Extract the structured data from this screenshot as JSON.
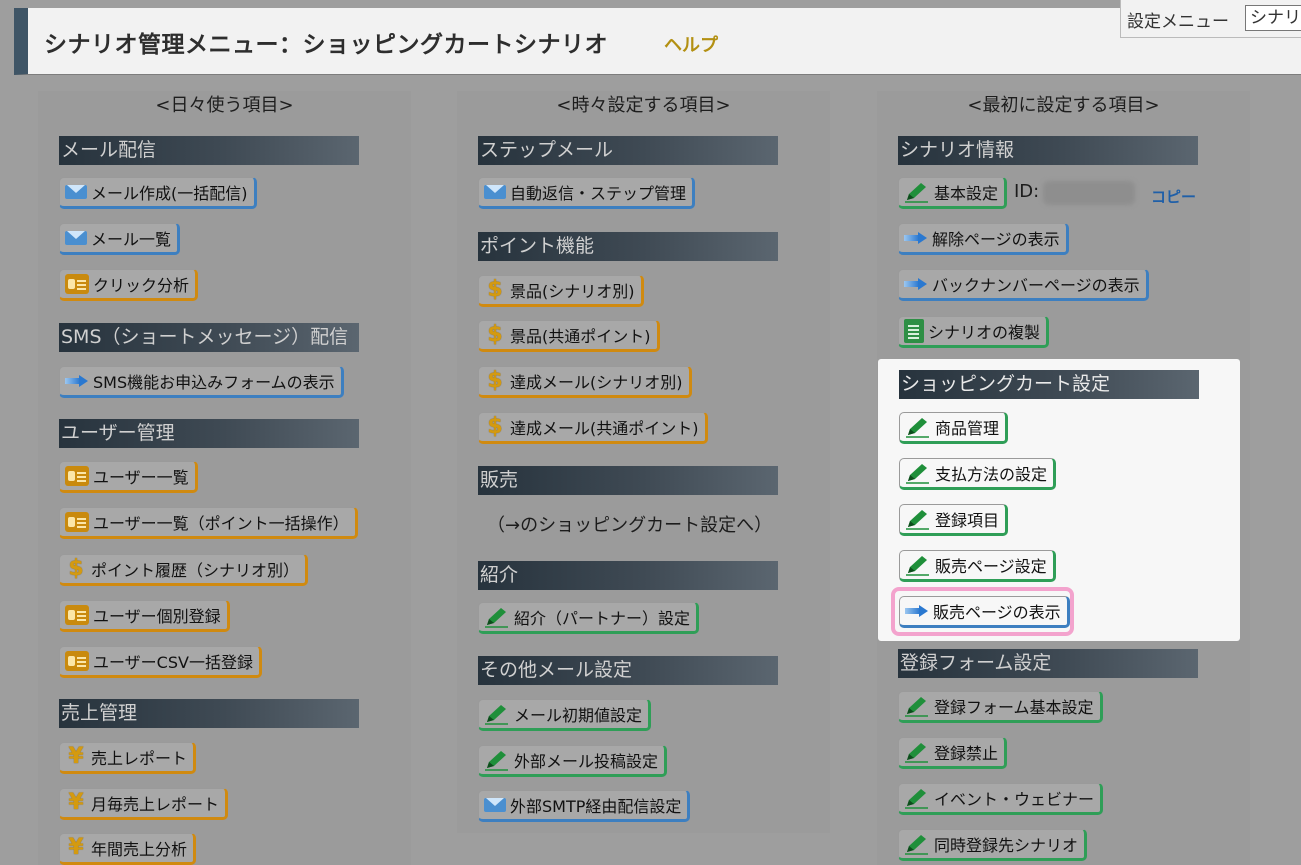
{
  "header": {
    "title": "シナリオ管理メニュー：ショッピングカートシナリオ",
    "help": "ヘルプ",
    "settings_menu_label": "設定メニュー",
    "settings_menu_value": "シナリ"
  },
  "columns": {
    "daily": {
      "title": "<日々使う項目>",
      "sections": {
        "mail": "メール配信",
        "sms": "SMS（ショートメッセージ）配信",
        "user": "ユーザー管理",
        "sales": "売上管理"
      },
      "buttons": {
        "mail_create": "メール作成(一括配信)",
        "mail_list": "メール一覧",
        "click_analysis": "クリック分析",
        "sms_form": "SMS機能お申込みフォームの表示",
        "user_list": "ユーザー一覧",
        "user_list_points": "ユーザー一覧（ポイント一括操作）",
        "point_history": "ポイント履歴（シナリオ別）",
        "user_register": "ユーザー個別登録",
        "user_csv": "ユーザーCSV一括登録",
        "sales_report": "売上レポート",
        "monthly_sales": "月毎売上レポート",
        "annual_sales": "年間売上分析"
      }
    },
    "sometimes": {
      "title": "<時々設定する項目>",
      "sections": {
        "step_mail": "ステップメール",
        "points": "ポイント機能",
        "sales": "販売",
        "referral": "紹介",
        "other_mail": "その他メール設定"
      },
      "buttons": {
        "auto_reply": "自動返信・ステップ管理",
        "prize_scenario": "景品(シナリオ別)",
        "prize_common": "景品(共通ポイント)",
        "achieve_scenario": "達成メール(シナリオ別)",
        "achieve_common": "達成メール(共通ポイント)",
        "referral_partner": "紹介（パートナー）設定",
        "mail_defaults": "メール初期値設定",
        "external_post": "外部メール投稿設定",
        "external_smtp": "外部SMTP経由配信設定"
      },
      "sales_note": "（→のショッピングカート設定へ）"
    },
    "first": {
      "title": "<最初に設定する項目>",
      "sections": {
        "scenario_info": "シナリオ情報",
        "cart_settings": "ショッピングカート設定",
        "form_settings": "登録フォーム設定"
      },
      "buttons": {
        "basic_settings": "基本設定",
        "unsubscribe_page": "解除ページの表示",
        "backnumber_page": "バックナンバーページの表示",
        "duplicate": "シナリオの複製",
        "product_mgmt": "商品管理",
        "payment_method": "支払方法の設定",
        "registration_items": "登録項目",
        "sales_page_settings": "販売ページ設定",
        "sales_page_view": "販売ページの表示",
        "form_basic": "登録フォーム基本設定",
        "registration_block": "登録禁止",
        "event_webinar": "イベント・ウェビナー",
        "simultaneous_scenario": "同時登録先シナリオ"
      },
      "id_label": "ID:",
      "copy": "コピー"
    }
  },
  "icons": {
    "mail": "mail-icon",
    "arrow": "arrow-icon",
    "card": "id-card-icon",
    "dollar": "dollar-icon",
    "yen": "yen-icon",
    "pencil": "pencil-icon",
    "document": "document-icon"
  },
  "colors": {
    "header_accent": "#3f5566",
    "help_link": "#b39012",
    "button_blue": "#3d7fc0",
    "button_orange": "#d08a10",
    "button_green": "#2f9e57",
    "highlight_ring": "#f3a3cd"
  }
}
